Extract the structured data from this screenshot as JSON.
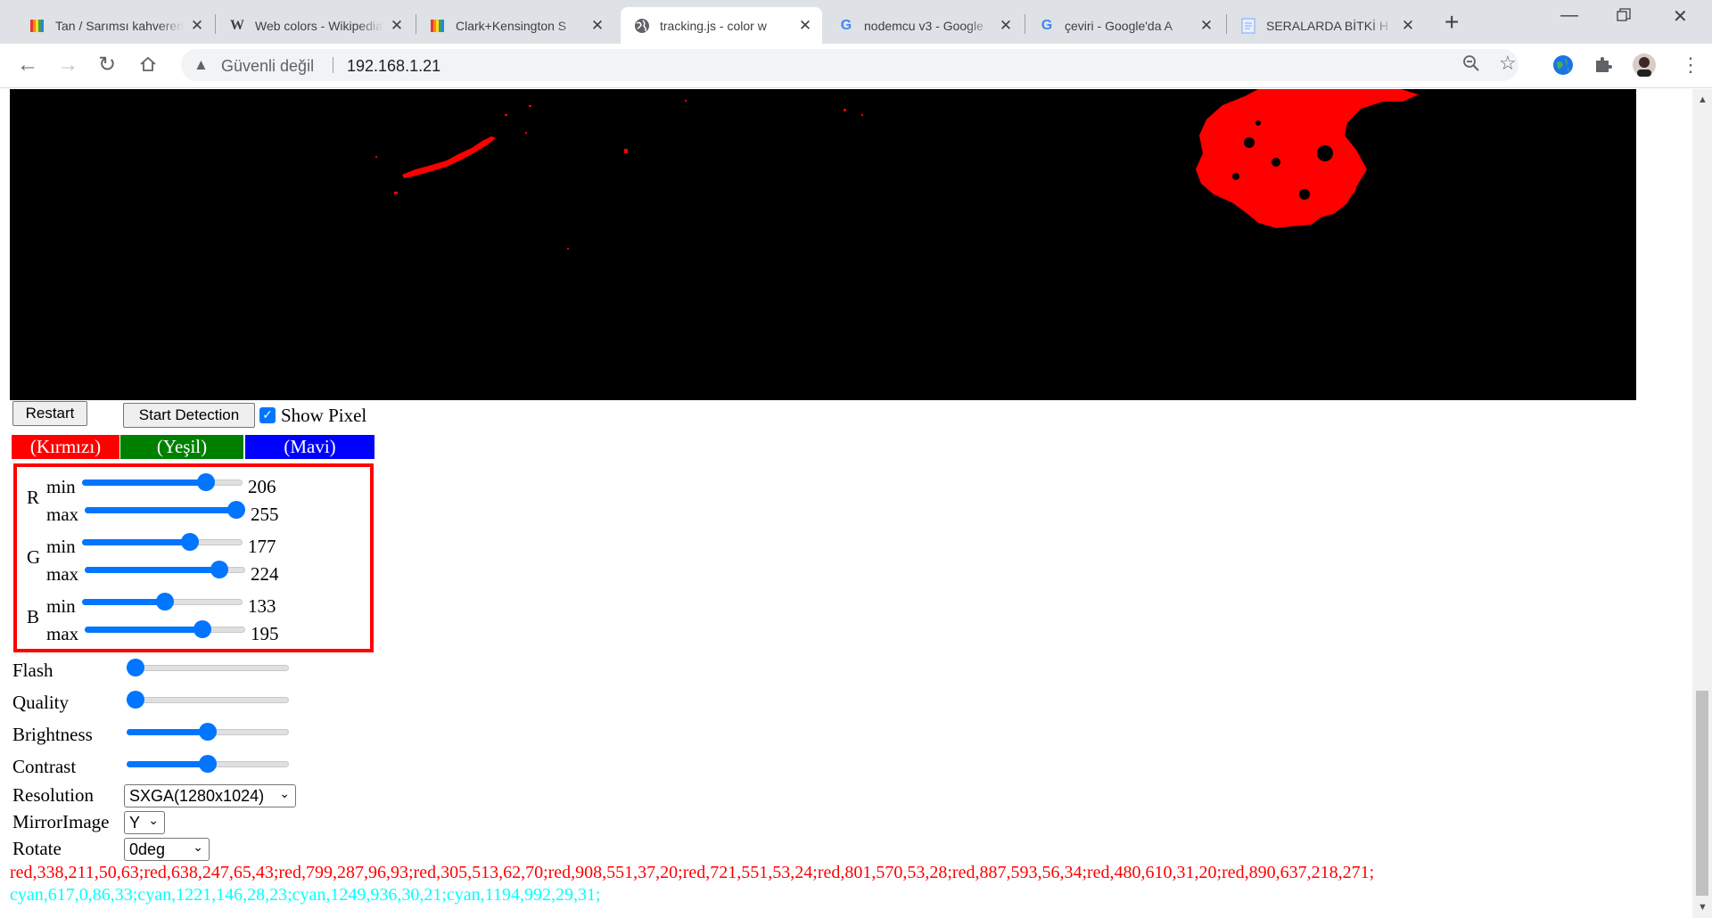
{
  "browser": {
    "tabs": [
      {
        "title": "Tan / Sarımsı kahverengi",
        "icon": "rainbow-book-icon"
      },
      {
        "title": "Web colors - Wikipedia",
        "icon": "wikipedia-icon"
      },
      {
        "title": "Clark+Kensington S",
        "icon": "rainbow-book-icon"
      },
      {
        "title": "tracking.js - color w",
        "icon": "globe-icon",
        "active": true
      },
      {
        "title": "nodemcu v3 - Google",
        "icon": "google-icon"
      },
      {
        "title": "çeviri - Google'da A",
        "icon": "google-icon"
      },
      {
        "title": "SERALARDA BİTKİ H",
        "icon": "document-icon"
      }
    ],
    "security_label": "Güvenli değil",
    "url": "192.168.1.21"
  },
  "controls": {
    "restart_label": "Restart",
    "start_detection_label": "Start Detection",
    "show_pixel_label": "Show Pixel",
    "show_pixel_checked": true
  },
  "color_bars": [
    {
      "label": "(Kırmızı)",
      "color": "#ff0000"
    },
    {
      "label": "(Yeşil)",
      "color": "#008000"
    },
    {
      "label": "(Mavi)",
      "color": "#0000ff"
    }
  ],
  "rgb_ranges": [
    {
      "channel": "R",
      "min_label": "min",
      "max_label": "max",
      "min": 206,
      "max": 255
    },
    {
      "channel": "G",
      "min_label": "min",
      "max_label": "max",
      "min": 177,
      "max": 224
    },
    {
      "channel": "B",
      "min_label": "min",
      "max_label": "max",
      "min": 133,
      "max": 195
    }
  ],
  "camera_sliders": [
    {
      "label": "Flash",
      "value_fraction": 0.0
    },
    {
      "label": "Quality",
      "value_fraction": 0.0
    },
    {
      "label": "Brightness",
      "value_fraction": 0.5
    },
    {
      "label": "Contrast",
      "value_fraction": 0.5
    }
  ],
  "selects": [
    {
      "label": "Resolution",
      "value": "SXGA(1280x1024)"
    },
    {
      "label": "MirrorImage",
      "value": "Y"
    },
    {
      "label": "Rotate",
      "value": "0deg"
    }
  ],
  "output": {
    "red_text": "red,338,211,50,63;red,638,247,65,43;red,799,287,96,93;red,305,513,62,70;red,908,551,37,20;red,721,551,53,24;red,801,570,53,28;red,887,593,56,34;red,480,610,31,20;red,890,637,218,271;",
    "red_color": "#ff0000",
    "cyan_text": "cyan,617,0,86,33;cyan,1221,146,28,23;cyan,1249,936,30,21;cyan,1194,992,29,31;",
    "cyan_color": "#00ffff"
  }
}
